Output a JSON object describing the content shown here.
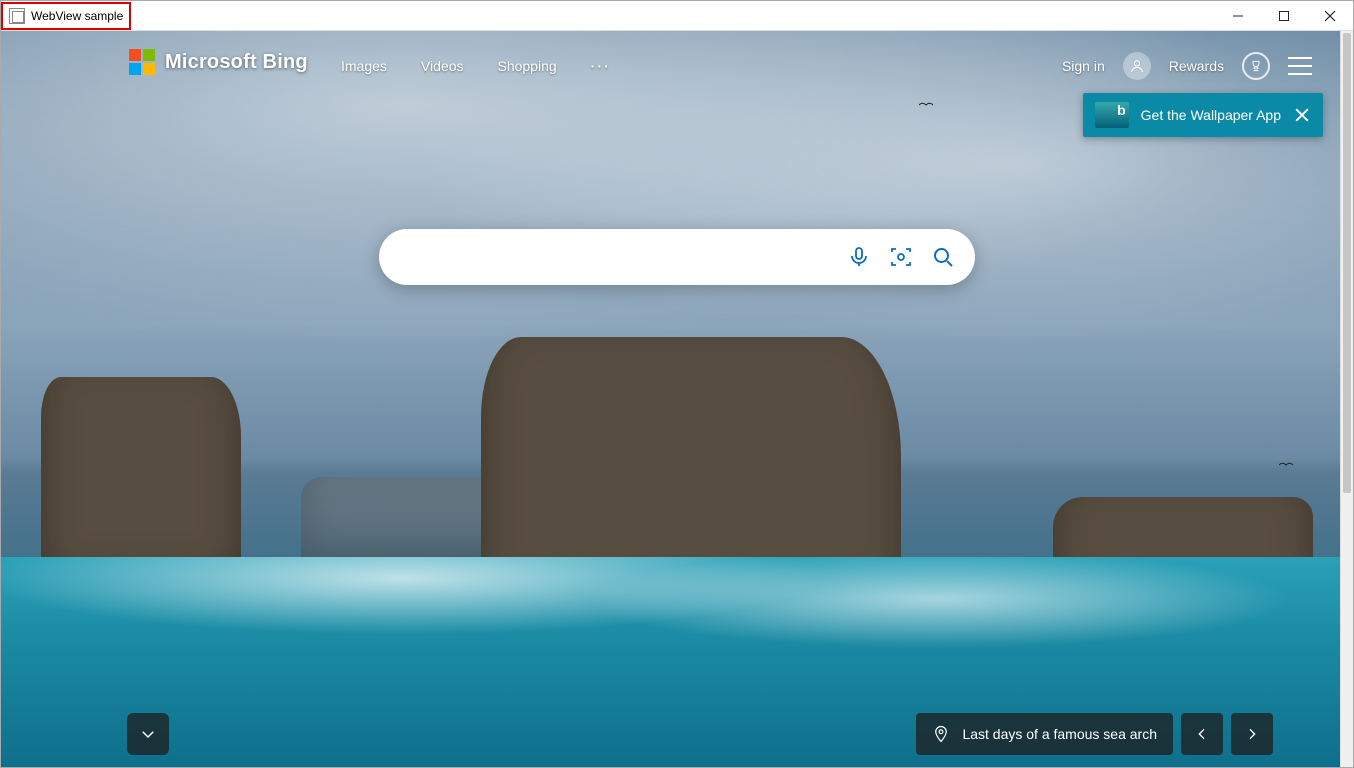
{
  "window": {
    "title": "WebView sample"
  },
  "brand": "Microsoft Bing",
  "nav": {
    "images": "Images",
    "videos": "Videos",
    "shopping": "Shopping",
    "more": "···",
    "signin": "Sign in",
    "rewards": "Rewards"
  },
  "wallpaper_banner": {
    "text": "Get the Wallpaper App"
  },
  "search": {
    "placeholder": ""
  },
  "imageinfo": {
    "caption": "Last days of a famous sea arch"
  }
}
